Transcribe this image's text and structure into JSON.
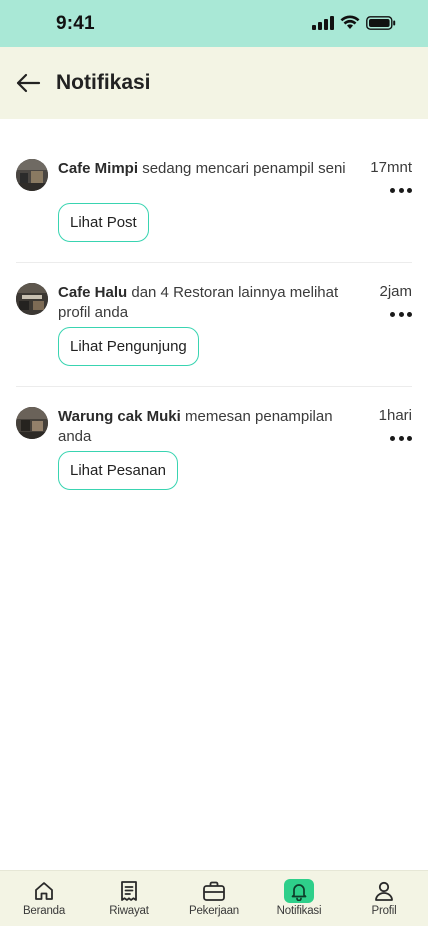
{
  "status_bar": {
    "time": "9:41",
    "icons": [
      "signal-icon",
      "wifi-icon",
      "battery-icon"
    ],
    "color": "#a9e8d6"
  },
  "header": {
    "title": "Notifikasi",
    "back_icon": "arrow-left-icon",
    "color": "#f3f4e4"
  },
  "accent_color": "#39d4b1",
  "notifications": [
    {
      "sender": "Cafe Mimpi",
      "message": "sedang mencari penampil seni",
      "time": "17mnt",
      "action": "Lihat Post"
    },
    {
      "sender": "Cafe Halu",
      "message": "dan 4 Restoran lainnya melihat profil anda",
      "time": "2jam",
      "action": "Lihat Pengunjung"
    },
    {
      "sender": "Warung cak Muki",
      "message": "memesan penampilan anda",
      "time": "1hari",
      "action": "Lihat Pesanan"
    }
  ],
  "bottom_nav": {
    "active": "Notifikasi",
    "active_color": "#2ecf8a",
    "items": [
      {
        "label": "Beranda",
        "icon": "home-icon"
      },
      {
        "label": "Riwayat",
        "icon": "receipt-icon"
      },
      {
        "label": "Pekerjaan",
        "icon": "briefcase-icon"
      },
      {
        "label": "Notifikasi",
        "icon": "bell-icon"
      },
      {
        "label": "Profil",
        "icon": "user-icon"
      }
    ]
  }
}
